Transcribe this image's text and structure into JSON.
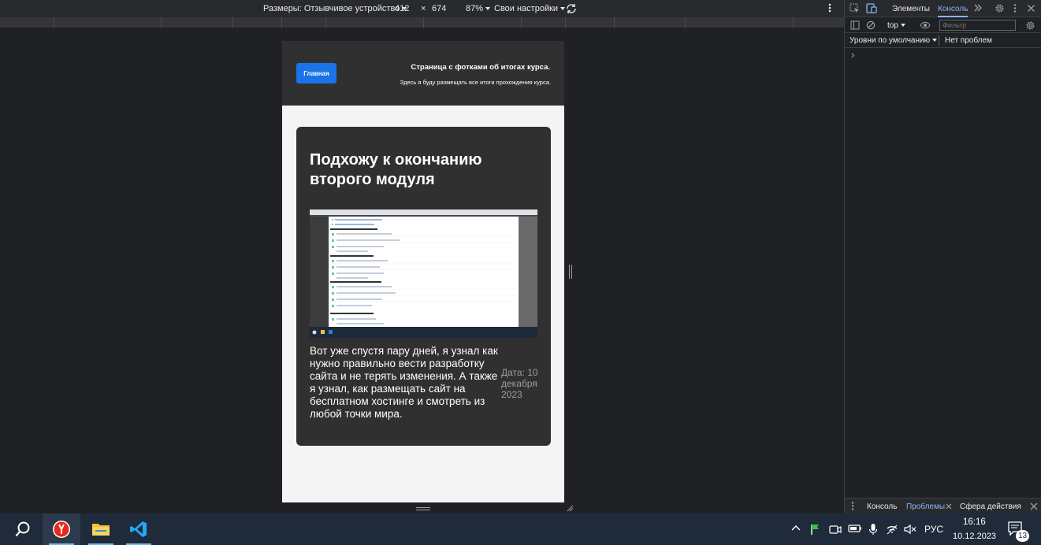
{
  "device_toolbar": {
    "dimensions_label": "Размеры: Отзывчивое устройство",
    "width": "412",
    "times": "×",
    "height": "674",
    "zoom": "87%",
    "throttle": "Свои настройки"
  },
  "site": {
    "home_button": "Главная",
    "header_title": "Страница с фотками об итогах курса.",
    "header_subtitle": "Здесь я буду размещать все итоги прохождения курса.",
    "post": {
      "title": "Подхожу к окончанию второго модуля",
      "text": "Вот уже спустя пару дней, я узнал как нужно правильно вести разработку сайта и не терять изменения. А также я узнал, как размещать сайт на бесплатном хостинге и смотреть из любой точки мира.",
      "date": "Дата: 10 декабря 2023"
    }
  },
  "devtools": {
    "tabs": [
      "Элементы",
      "Консоль"
    ],
    "active_tab": "Консоль",
    "context": "top",
    "filter_placeholder": "Фильтр",
    "levels": "Уровни по умолчанию",
    "issues": "Нет проблем",
    "prompt": "›",
    "drawer_tabs": [
      "Консоль",
      "Проблемы",
      "Сфера действия"
    ],
    "drawer_active": "Проблемы"
  },
  "taskbar": {
    "language": "РУС",
    "time": "16:16",
    "date": "10.12.2023",
    "notifications": "13"
  },
  "colors": {
    "accent": "#1a73e8",
    "devtools_bg": "#202124",
    "taskbar_bg": "#1f2a3a"
  }
}
